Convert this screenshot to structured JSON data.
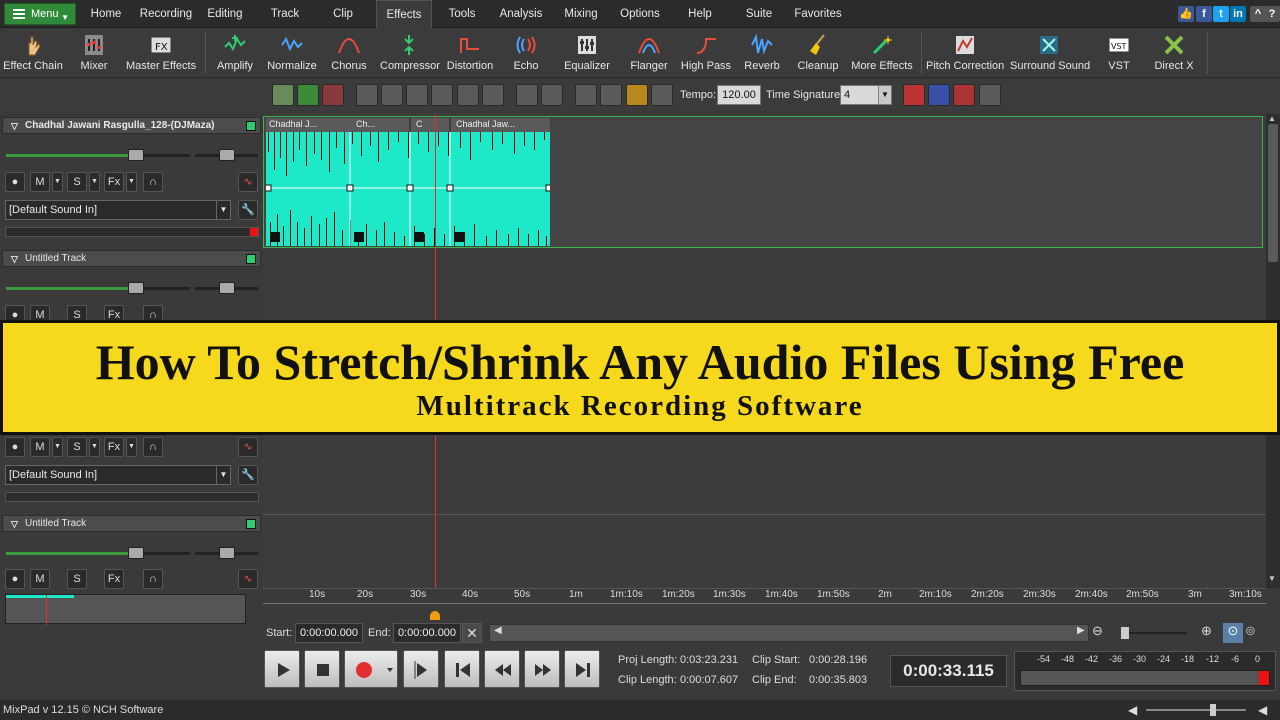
{
  "menubar": {
    "menu_label": "Menu",
    "tabs": [
      "Home",
      "Recording",
      "Editing",
      "Track",
      "Clip",
      "Effects",
      "Tools",
      "Analysis",
      "Mixing",
      "Options",
      "Help",
      "Suite",
      "Favorites"
    ],
    "active_tab": "Effects"
  },
  "toolbar": {
    "tools": [
      {
        "label": "Effect Chain",
        "icon": "hand-icon"
      },
      {
        "label": "Mixer",
        "icon": "mixer-icon"
      },
      {
        "label": "Master Effects",
        "icon": "master-fx-icon"
      },
      {
        "label": "Amplify",
        "icon": "amplify-icon"
      },
      {
        "label": "Normalize",
        "icon": "normalize-icon"
      },
      {
        "label": "Chorus",
        "icon": "chorus-icon"
      },
      {
        "label": "Compressor",
        "icon": "compressor-icon"
      },
      {
        "label": "Distortion",
        "icon": "distortion-icon"
      },
      {
        "label": "Echo",
        "icon": "echo-icon"
      },
      {
        "label": "Equalizer",
        "icon": "equalizer-icon"
      },
      {
        "label": "Flanger",
        "icon": "flanger-icon"
      },
      {
        "label": "High Pass",
        "icon": "high-pass-icon"
      },
      {
        "label": "Reverb",
        "icon": "reverb-icon"
      },
      {
        "label": "Cleanup",
        "icon": "broom-icon"
      },
      {
        "label": "More Effects",
        "icon": "wand-icon"
      },
      {
        "label": "Pitch Correction",
        "icon": "pitch-icon"
      },
      {
        "label": "Surround Sound",
        "icon": "surround-icon"
      },
      {
        "label": "VST",
        "icon": "vst-icon"
      },
      {
        "label": "Direct X",
        "icon": "directx-icon"
      }
    ]
  },
  "subbar": {
    "tempo_label": "Tempo:",
    "tempo_value": "120.00",
    "ts_label": "Time Signature:",
    "ts_value": "4"
  },
  "tracks": [
    {
      "name": "Chadhal Jawani Rasgulla_128-(DJMaza)",
      "input": "[Default Sound In]"
    },
    {
      "name": "Untitled Track",
      "input": "[Default Sound In]"
    },
    {
      "name": "Untitled Track",
      "input": ""
    }
  ],
  "track_buttons": {
    "mute": "M",
    "solo": "S",
    "fx": "Fx"
  },
  "clips": [
    "Chadhal J...",
    "Ch...",
    "C",
    "Chadhal Jaw..."
  ],
  "banner": {
    "title": "How To Stretch/Shrink Any Audio Files Using Free",
    "subtitle": "Multitrack Recording Software"
  },
  "ruler": [
    "10s",
    "20s",
    "30s",
    "40s",
    "50s",
    "1m",
    "1m:10s",
    "1m:20s",
    "1m:30s",
    "1m:40s",
    "1m:50s",
    "2m",
    "2m:10s",
    "2m:20s",
    "2m:30s",
    "2m:40s",
    "2m:50s",
    "3m",
    "3m:10s"
  ],
  "position": {
    "start_label": "Start:",
    "start_value": "0:00:00.000",
    "end_label": "End:",
    "end_value": "0:00:00.000"
  },
  "info": {
    "proj_length_label": "Proj Length:",
    "proj_length": "0:03:23.231",
    "clip_length_label": "Clip Length:",
    "clip_length": "0:00:07.607",
    "clip_start_label": "Clip Start:",
    "clip_start": "0:00:28.196",
    "clip_end_label": "Clip End:",
    "clip_end": "0:00:35.803"
  },
  "bigtime": "0:00:33.115",
  "vu_scale": [
    "-54",
    "-48",
    "-42",
    "-36",
    "-30",
    "-24",
    "-18",
    "-12",
    "-6",
    "0"
  ],
  "status": "MixPad v 12.15 © NCH Software",
  "colors": {
    "waveform": "#1de9c8",
    "accent_green": "#2f8a3a",
    "banner": "#f6d81c",
    "playhead": "#e03030"
  }
}
